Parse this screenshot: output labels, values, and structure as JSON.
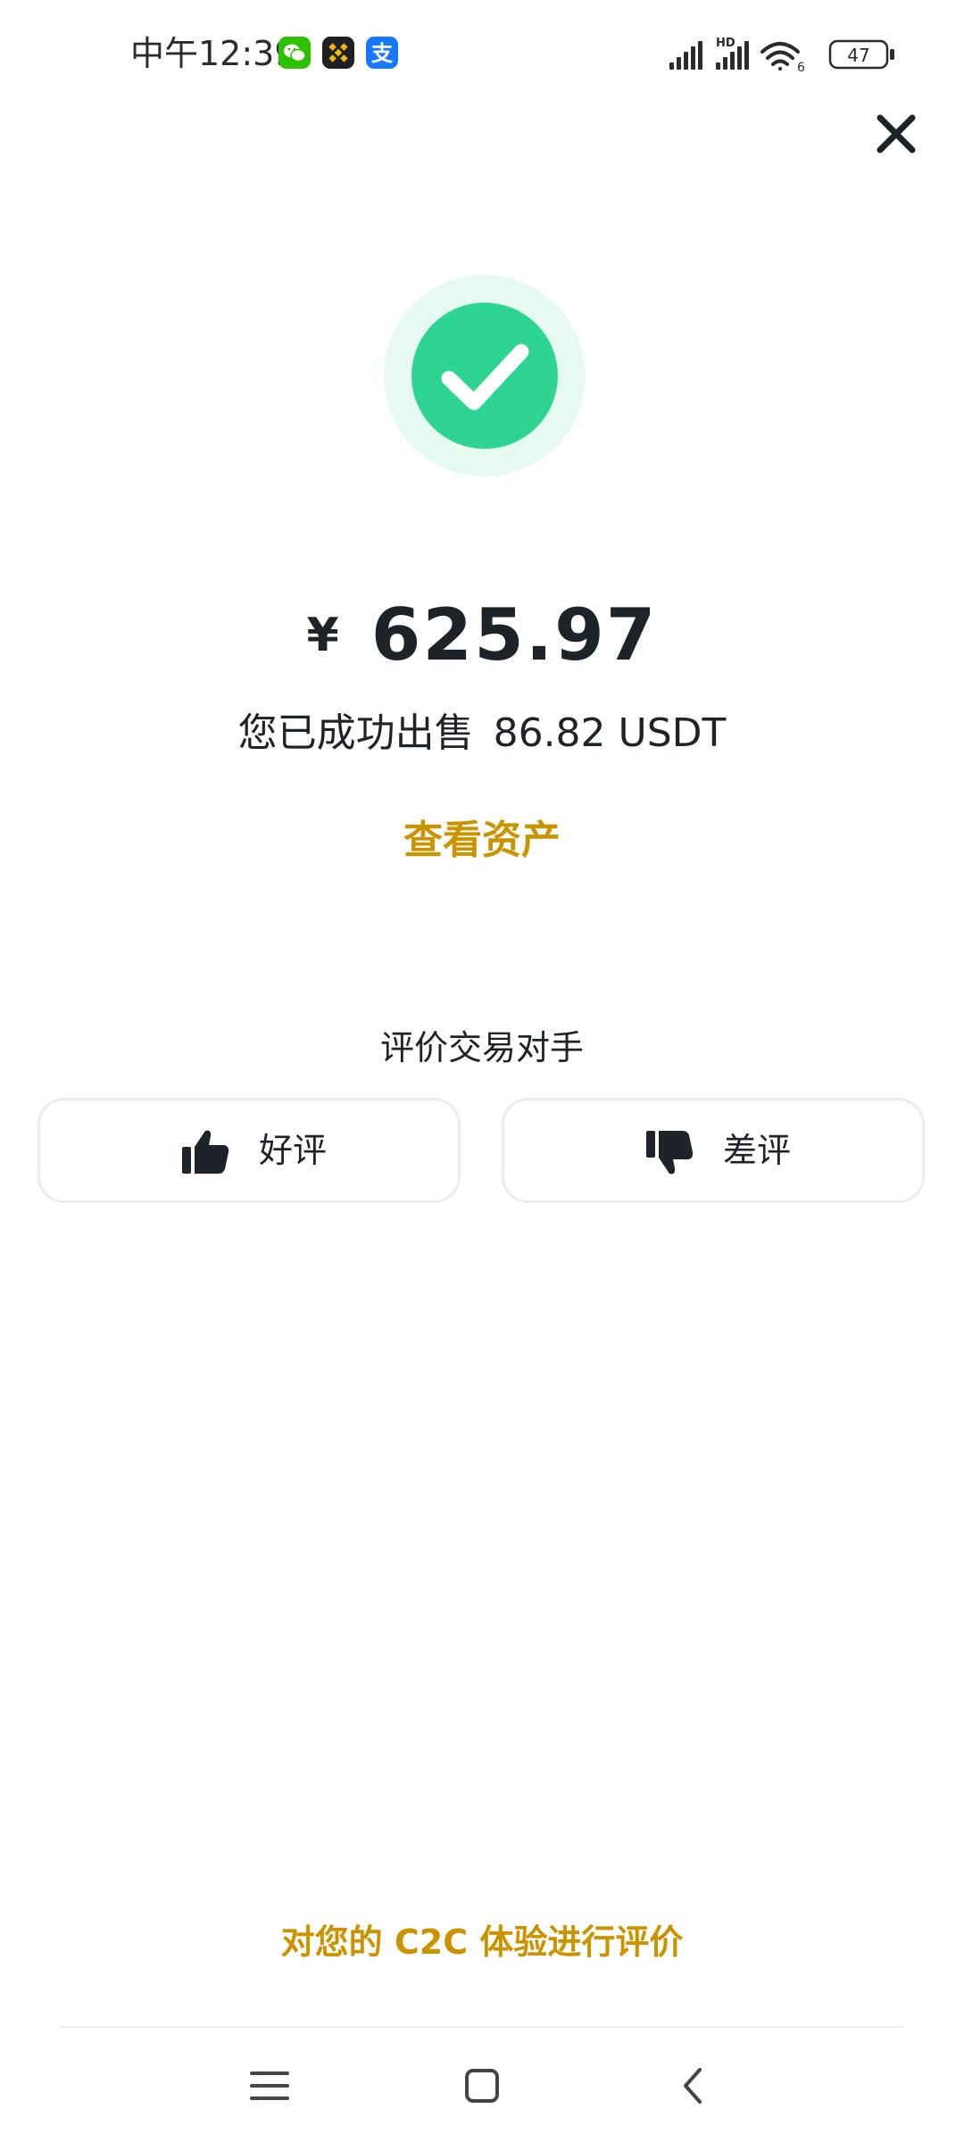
{
  "status_bar": {
    "time": "中午12:39",
    "network_label": "HD",
    "wifi_label": "6",
    "battery_level": "47"
  },
  "result": {
    "currency_symbol": "¥",
    "amount": "625.97",
    "sold_text": "您已成功出售",
    "sold_amount": "86.82 USDT",
    "view_assets_label": "查看资产"
  },
  "rating": {
    "title": "评价交易对手",
    "good_label": "好评",
    "bad_label": "差评"
  },
  "footer": {
    "c2c_feedback_label": "对您的 C2C 体验进行评价"
  },
  "colors": {
    "accent": "#c99400",
    "success": "#2ed592",
    "success_halo": "#e6faf2",
    "text": "#1e2329",
    "border": "#eaecef"
  },
  "icons": {
    "close": "close-icon",
    "success": "check-circle-icon",
    "good": "thumbs-up-icon",
    "bad": "thumbs-down-icon",
    "nav_menu": "menu-icon",
    "nav_home": "home-square-icon",
    "nav_back": "back-chevron-icon"
  }
}
